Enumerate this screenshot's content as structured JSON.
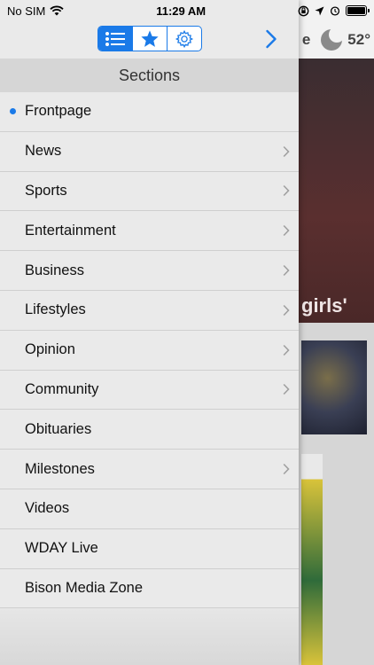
{
  "status_bar": {
    "carrier": "No SIM",
    "time": "11:29 AM"
  },
  "background": {
    "weather_temp": "52°",
    "weather_partial_text": "e",
    "headline_partial": "girls'"
  },
  "toolbar": {
    "segments": [
      {
        "icon": "list-icon",
        "active": true
      },
      {
        "icon": "star-icon",
        "active": false
      },
      {
        "icon": "gear-icon",
        "active": false
      }
    ],
    "next_icon": "chevron-right-icon"
  },
  "sections": {
    "title": "Sections",
    "items": [
      {
        "label": "Frontpage",
        "selected": true,
        "has_children": false
      },
      {
        "label": "News",
        "selected": false,
        "has_children": true
      },
      {
        "label": "Sports",
        "selected": false,
        "has_children": true
      },
      {
        "label": "Entertainment",
        "selected": false,
        "has_children": true
      },
      {
        "label": "Business",
        "selected": false,
        "has_children": true
      },
      {
        "label": "Lifestyles",
        "selected": false,
        "has_children": true
      },
      {
        "label": "Opinion",
        "selected": false,
        "has_children": true
      },
      {
        "label": "Community",
        "selected": false,
        "has_children": true
      },
      {
        "label": "Obituaries",
        "selected": false,
        "has_children": false
      },
      {
        "label": "Milestones",
        "selected": false,
        "has_children": true
      },
      {
        "label": "Videos",
        "selected": false,
        "has_children": false
      },
      {
        "label": "WDAY Live",
        "selected": false,
        "has_children": false
      },
      {
        "label": "Bison Media Zone",
        "selected": false,
        "has_children": false
      }
    ]
  },
  "colors": {
    "accent": "#1a7ae8",
    "drawer_bg": "#eaeaea",
    "header_bg": "#d6d6d6"
  }
}
